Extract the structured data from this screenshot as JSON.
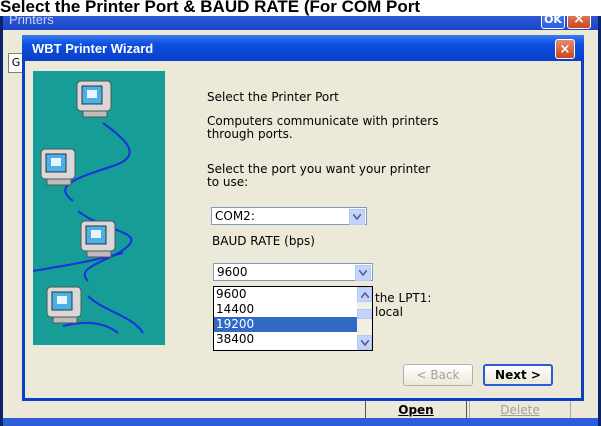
{
  "banner": {
    "text": "Select the Printer Port & BAUD RATE (For COM Port"
  },
  "background_window": {
    "title": "Printers",
    "ok_label": "OK",
    "close_label": "×",
    "tab_letter": "G",
    "open_label": "Open",
    "delete_label": "Delete"
  },
  "wizard": {
    "title": "WBT Printer Wizard",
    "close_label": "×",
    "heading": "Select the Printer Port",
    "description_line1": "Computers communicate with printers",
    "description_line2": "through ports.",
    "port_prompt_line1": "Select the port you want your printer",
    "port_prompt_line2": "to use:",
    "port_value": "COM2:",
    "baud_label": "BAUD RATE (bps)",
    "baud_value": "9600",
    "baud_options": [
      "9600",
      "14400",
      "19200",
      "38400"
    ],
    "baud_highlighted": "19200",
    "hidden_text_line1": "the LPT1:",
    "hidden_text_line2": "local",
    "back_label": "< Back",
    "next_label": "Next >"
  },
  "colors": {
    "title_bar": "#0a3fc8",
    "panel": "#169d97",
    "selection": "#316ac5",
    "dialog_bg": "#ece9d8"
  }
}
